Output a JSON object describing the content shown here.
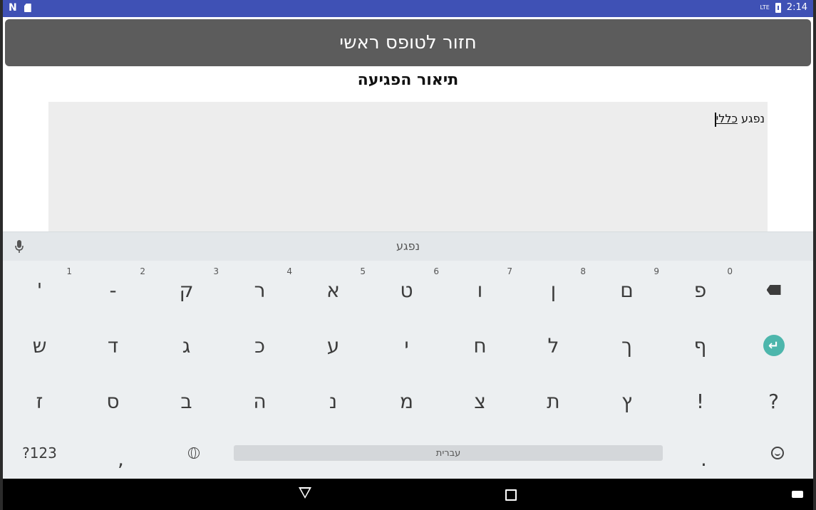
{
  "status_bar": {
    "network": "LTE",
    "time": "2:14"
  },
  "header": {
    "home_button_label": "חזור לטופס ראשי"
  },
  "page": {
    "title": "תיאור הפגיעה"
  },
  "text_area": {
    "prefix": "נפגע ",
    "underlined_word": "כללי"
  },
  "keyboard": {
    "suggestion": "נפגע",
    "row1": [
      {
        "label": "'",
        "hint": "1"
      },
      {
        "label": "-",
        "hint": "2"
      },
      {
        "label": "ק",
        "hint": "3"
      },
      {
        "label": "ר",
        "hint": "4"
      },
      {
        "label": "א",
        "hint": "5"
      },
      {
        "label": "ט",
        "hint": "6"
      },
      {
        "label": "ו",
        "hint": "7"
      },
      {
        "label": "ן",
        "hint": "8"
      },
      {
        "label": "ם",
        "hint": "9"
      },
      {
        "label": "פ",
        "hint": "0"
      }
    ],
    "row2": [
      "ש",
      "ד",
      "ג",
      "כ",
      "ע",
      "י",
      "ח",
      "ל",
      "ך",
      "ף"
    ],
    "row3": [
      "ז",
      "ס",
      "ב",
      "ה",
      "נ",
      "מ",
      "צ",
      "ת",
      "ץ",
      "!",
      "?"
    ],
    "symbols_key": "?123",
    "comma_key": ",",
    "space_label": "עברית",
    "period_key": "."
  }
}
